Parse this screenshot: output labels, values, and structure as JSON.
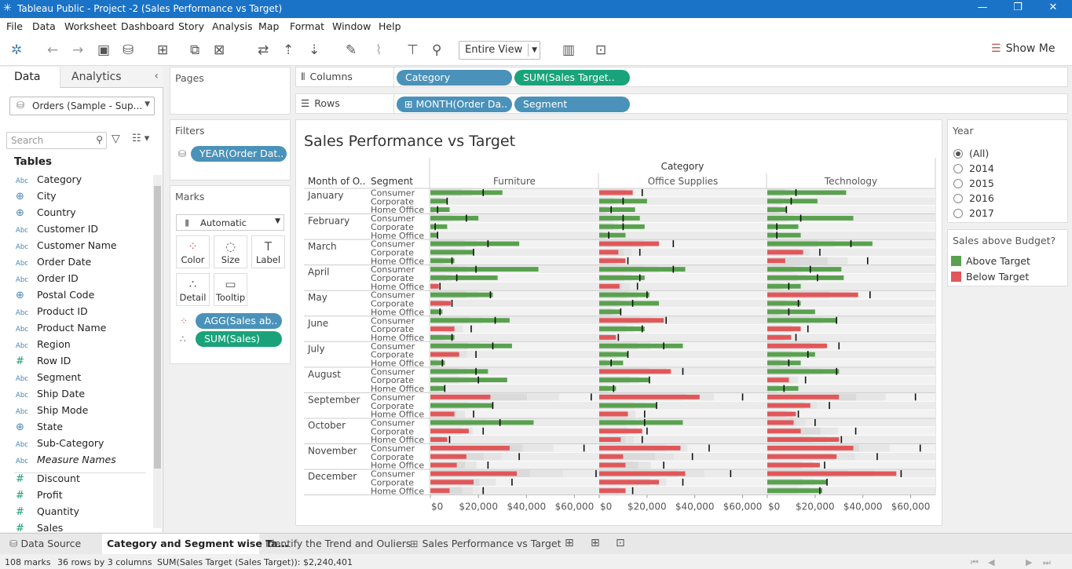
{
  "window": {
    "title": "Tableau Public - Project -2 (Sales Performance vs Target)"
  },
  "menu": [
    "File",
    "Data",
    "Worksheet",
    "Dashboard",
    "Story",
    "Analysis",
    "Map",
    "Format",
    "Window",
    "Help"
  ],
  "toolbar": {
    "fit": "Entire View",
    "show_me": "Show Me"
  },
  "left_pane": {
    "tab_data": "Data",
    "tab_analytics": "Analytics",
    "datasource": "Orders (Sample - Sup...",
    "search_placeholder": "Search",
    "tables_heading": "Tables",
    "fields": [
      {
        "type": "Abc",
        "name": "Category"
      },
      {
        "type": "globe",
        "name": "City"
      },
      {
        "type": "globe",
        "name": "Country"
      },
      {
        "type": "Abc",
        "name": "Customer ID"
      },
      {
        "type": "Abc",
        "name": "Customer Name"
      },
      {
        "type": "cal",
        "name": "Order Date"
      },
      {
        "type": "Abc",
        "name": "Order ID"
      },
      {
        "type": "globe",
        "name": "Postal Code"
      },
      {
        "type": "Abc",
        "name": "Product ID"
      },
      {
        "type": "Abc",
        "name": "Product Name"
      },
      {
        "type": "Abc",
        "name": "Region"
      },
      {
        "type": "#",
        "name": "Row ID"
      },
      {
        "type": "Abc",
        "name": "Segment"
      },
      {
        "type": "cal",
        "name": "Ship Date"
      },
      {
        "type": "Abc",
        "name": "Ship Mode"
      },
      {
        "type": "globe",
        "name": "State"
      },
      {
        "type": "Abc",
        "name": "Sub-Category"
      },
      {
        "type": "Abc",
        "name": "Measure Names"
      },
      {
        "type": "#",
        "name": "Discount"
      },
      {
        "type": "#",
        "name": "Profit"
      },
      {
        "type": "#",
        "name": "Quantity"
      },
      {
        "type": "#",
        "name": "Sales"
      }
    ]
  },
  "pages": {
    "title": "Pages"
  },
  "filters": {
    "title": "Filters",
    "pill": "YEAR(Order Dat.."
  },
  "marks": {
    "title": "Marks",
    "type": "Automatic",
    "color": "Color",
    "size": "Size",
    "label": "Label",
    "detail": "Detail",
    "tooltip": "Tooltip",
    "pill_color": "AGG(Sales ab..",
    "pill_size": "SUM(Sales)"
  },
  "shelves": {
    "columns_label": "Columns",
    "rows_label": "Rows",
    "col1": "Category",
    "col2": "SUM(Sales Target..",
    "row1": "MONTH(Order Da..",
    "row2": "Segment"
  },
  "viz": {
    "title": "Sales Performance vs Target",
    "col_header": "Category",
    "row_header1": "Month of O..",
    "row_header2": "Segment"
  },
  "chart_data": {
    "type": "bar",
    "title": "Sales Performance vs Target",
    "categories": [
      "Furniture",
      "Office Supplies",
      "Technology"
    ],
    "months": [
      "January",
      "February",
      "March",
      "April",
      "May",
      "June",
      "July",
      "August",
      "September",
      "October",
      "November",
      "December"
    ],
    "segments": [
      "Consumer",
      "Corporate",
      "Home Office"
    ],
    "x_ticks": [
      "$0",
      "$20,000",
      "$40,000",
      "$60,000"
    ],
    "xlim": [
      0,
      70000
    ],
    "sales": {
      "Furniture": [
        [
          30000,
          7000,
          8000
        ],
        [
          20000,
          7000,
          3000
        ],
        [
          37000,
          18000,
          10000
        ],
        [
          45000,
          28000,
          3500
        ],
        [
          26000,
          8500,
          5000
        ],
        [
          33000,
          10000,
          10000
        ],
        [
          34000,
          12000,
          6000
        ],
        [
          24000,
          32000,
          6000
        ],
        [
          25000,
          26000,
          10000
        ],
        [
          43000,
          16000,
          7000
        ],
        [
          33000,
          15000,
          11000
        ],
        [
          36000,
          18000,
          8000
        ]
      ],
      "Office Supplies": [
        [
          14000,
          20000,
          15000
        ],
        [
          17000,
          19000,
          11000
        ],
        [
          25000,
          8000,
          11000
        ],
        [
          36000,
          19000,
          8500
        ],
        [
          21000,
          25000,
          9000
        ],
        [
          27000,
          19000,
          7000
        ],
        [
          35000,
          12000,
          10000
        ],
        [
          30000,
          21000,
          7000
        ],
        [
          42000,
          24000,
          12000
        ],
        [
          35000,
          18000,
          9000
        ],
        [
          34000,
          10000,
          11000
        ],
        [
          36000,
          25000,
          11000
        ]
      ],
      "Technology": [
        [
          33000,
          21000,
          8000
        ],
        [
          36000,
          13000,
          14000
        ],
        [
          44000,
          15000,
          7500
        ],
        [
          31000,
          32000,
          14000
        ],
        [
          38000,
          14000,
          20000
        ],
        [
          29000,
          14000,
          10000
        ],
        [
          25000,
          20000,
          14000
        ],
        [
          30000,
          9000,
          13000
        ],
        [
          30000,
          18000,
          12000
        ],
        [
          11000,
          14000,
          30000
        ],
        [
          36000,
          29000,
          22000
        ],
        [
          54000,
          25000,
          23000
        ]
      ]
    },
    "target": {
      "Furniture": [
        [
          22000,
          7000,
          3000
        ],
        [
          15000,
          2000,
          3000
        ],
        [
          24000,
          18000,
          9000
        ],
        [
          19000,
          11000,
          4000
        ],
        [
          25000,
          9000,
          4000
        ],
        [
          27000,
          17000,
          9000
        ],
        [
          26000,
          19000,
          5000
        ],
        [
          19000,
          20000,
          6000
        ],
        [
          67000,
          26000,
          18000
        ],
        [
          29000,
          22000,
          8000
        ],
        [
          64000,
          37000,
          24000
        ],
        [
          69000,
          34000,
          22000
        ]
      ],
      "Office Supplies": [
        [
          18000,
          10000,
          5000
        ],
        [
          10000,
          10000,
          4000
        ],
        [
          31000,
          17000,
          12000
        ],
        [
          31000,
          17000,
          16000
        ],
        [
          20000,
          14000,
          9000
        ],
        [
          28000,
          18000,
          8000
        ],
        [
          27000,
          12000,
          5000
        ],
        [
          35000,
          21000,
          6000
        ],
        [
          60000,
          24000,
          19000
        ],
        [
          19000,
          20000,
          18000
        ],
        [
          46000,
          39000,
          27000
        ],
        [
          55000,
          35000,
          14000
        ]
      ],
      "Technology": [
        [
          12000,
          10000,
          8000
        ],
        [
          14000,
          4000,
          4000
        ],
        [
          35000,
          22000,
          42000
        ],
        [
          18000,
          21000,
          9000
        ],
        [
          43000,
          13000,
          9000
        ],
        [
          29000,
          17000,
          12000
        ],
        [
          30000,
          17000,
          9000
        ],
        [
          29000,
          16000,
          7000
        ],
        [
          62000,
          26000,
          13000
        ],
        [
          20000,
          37000,
          31000
        ],
        [
          64000,
          46000,
          24000
        ],
        [
          56000,
          25000,
          22000
        ]
      ]
    },
    "legend": {
      "title": "Sales above Budget?",
      "items": [
        {
          "name": "Above Target",
          "color": "#59a14f"
        },
        {
          "name": "Below Target",
          "color": "#e15759"
        }
      ]
    }
  },
  "year_filter": {
    "title": "Year",
    "options": [
      "(All)",
      "2014",
      "2015",
      "2016",
      "2017"
    ],
    "selected": "(All)"
  },
  "bottom_tabs": {
    "datasource": "Data Source",
    "sheets": [
      "Category and Segment wise Ta...",
      "Identify the Trend and Ouliers",
      "Sales Performance vs Target"
    ]
  },
  "status": {
    "marks": "108 marks",
    "grid": "36 rows by 3 columns",
    "sum": "SUM(Sales Target (Sales Target)): $2,240,401"
  },
  "colors": {
    "above": "#59a14f",
    "below": "#e15759",
    "title_bar": "#1a73c7"
  }
}
